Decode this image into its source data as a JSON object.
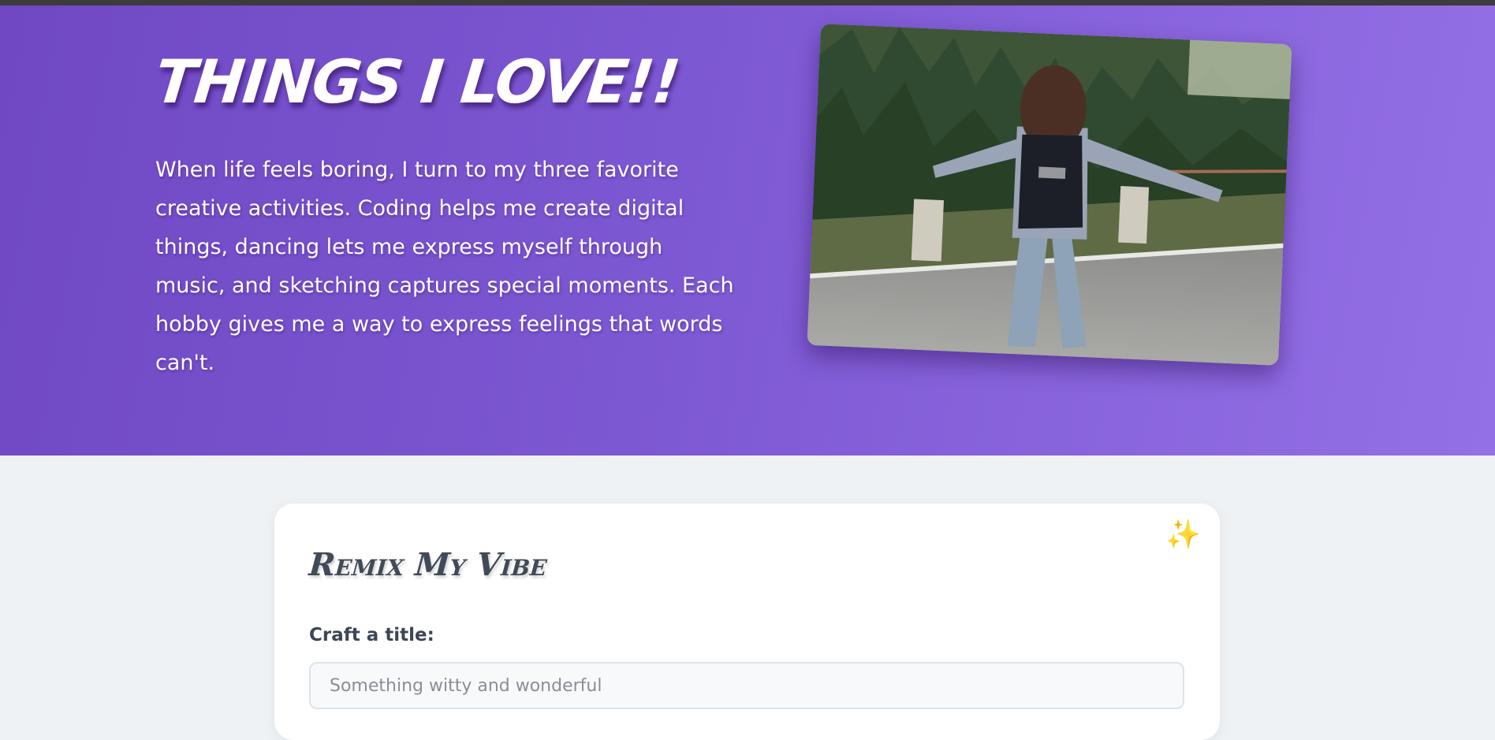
{
  "hero": {
    "title": "THINGS I LOVE!!",
    "description": "When life feels boring, I turn to my three favorite creative activities. Coding helps me create digital things, dancing lets me express myself through music, and sketching captures special moments. Each hobby gives me a way to express feelings that words can't.",
    "photo_icon": "photo-dancing-on-road"
  },
  "remix": {
    "heading": "Remix My Vibe",
    "sparkle_icon": "sparkles-icon",
    "title_label": "Craft a title:",
    "title_placeholder": "Something witty and wonderful"
  },
  "colors": {
    "hero_gradient_start": "#7048c4",
    "hero_gradient_end": "#9470e6",
    "page_background": "#eef2f5",
    "sparkle": "#f6c453"
  }
}
